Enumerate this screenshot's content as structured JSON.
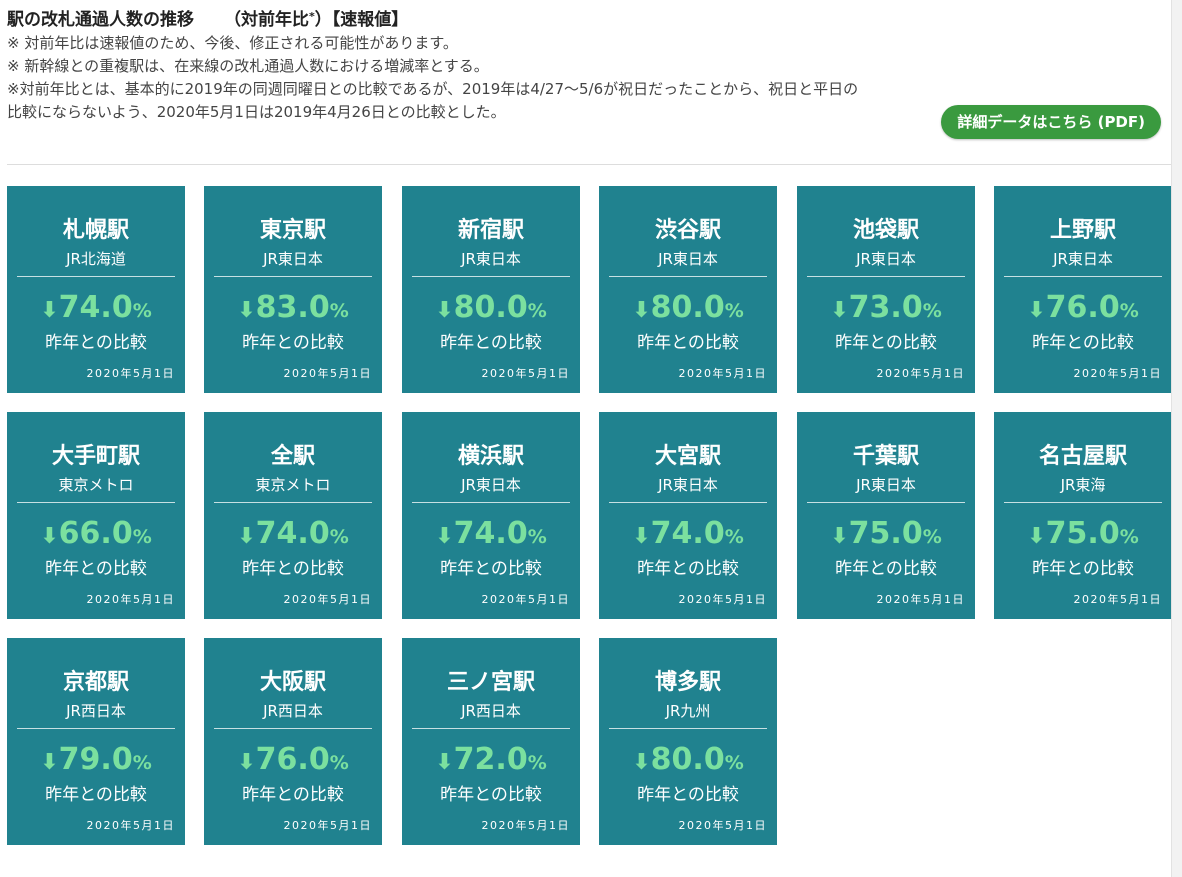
{
  "header": {
    "title_main": "駅の改札通過人数の推移",
    "title_yoy": "（対前年比",
    "title_mark": "*",
    "title_close": "）",
    "title_tag": "【速報値】",
    "notes": [
      "※ 対前年比は速報値のため、今後、修正される可能性があります。",
      "※ 新幹線との重複駅は、在来線の改札通過人数における増減率とする。",
      "※対前年比とは、基本的に2019年の同週同曜日との比較であるが、2019年は4/27～5/6が祝日だったことから、祝日と平日の比較にならないよう、2020年5月1日は2019年4月26日との比較とした。"
    ],
    "pdf_button": "詳細データはこちら (PDF)"
  },
  "colors": {
    "card_bg": "#20828f",
    "value_green": "#7be09f",
    "button_green": "#3a9a3f"
  },
  "stations": [
    {
      "name": "札幌駅",
      "operator": "JR北海道",
      "value": "74.0",
      "unit": "%",
      "arrow": "down-arrow-icon",
      "compare": "昨年との比較",
      "date": "2020年5月1日"
    },
    {
      "name": "東京駅",
      "operator": "JR東日本",
      "value": "83.0",
      "unit": "%",
      "arrow": "down-arrow-icon",
      "compare": "昨年との比較",
      "date": "2020年5月1日"
    },
    {
      "name": "新宿駅",
      "operator": "JR東日本",
      "value": "80.0",
      "unit": "%",
      "arrow": "down-arrow-icon",
      "compare": "昨年との比較",
      "date": "2020年5月1日"
    },
    {
      "name": "渋谷駅",
      "operator": "JR東日本",
      "value": "80.0",
      "unit": "%",
      "arrow": "down-arrow-icon",
      "compare": "昨年との比較",
      "date": "2020年5月1日"
    },
    {
      "name": "池袋駅",
      "operator": "JR東日本",
      "value": "73.0",
      "unit": "%",
      "arrow": "down-arrow-icon",
      "compare": "昨年との比較",
      "date": "2020年5月1日"
    },
    {
      "name": "上野駅",
      "operator": "JR東日本",
      "value": "76.0",
      "unit": "%",
      "arrow": "down-arrow-icon",
      "compare": "昨年との比較",
      "date": "2020年5月1日"
    },
    {
      "name": "大手町駅",
      "operator": "東京メトロ",
      "value": "66.0",
      "unit": "%",
      "arrow": "down-arrow-icon",
      "compare": "昨年との比較",
      "date": "2020年5月1日"
    },
    {
      "name": "全駅",
      "operator": "東京メトロ",
      "value": "74.0",
      "unit": "%",
      "arrow": "down-arrow-icon",
      "compare": "昨年との比較",
      "date": "2020年5月1日"
    },
    {
      "name": "横浜駅",
      "operator": "JR東日本",
      "value": "74.0",
      "unit": "%",
      "arrow": "down-arrow-icon",
      "compare": "昨年との比較",
      "date": "2020年5月1日"
    },
    {
      "name": "大宮駅",
      "operator": "JR東日本",
      "value": "74.0",
      "unit": "%",
      "arrow": "down-arrow-icon",
      "compare": "昨年との比較",
      "date": "2020年5月1日"
    },
    {
      "name": "千葉駅",
      "operator": "JR東日本",
      "value": "75.0",
      "unit": "%",
      "arrow": "down-arrow-icon",
      "compare": "昨年との比較",
      "date": "2020年5月1日"
    },
    {
      "name": "名古屋駅",
      "operator": "JR東海",
      "value": "75.0",
      "unit": "%",
      "arrow": "down-arrow-icon",
      "compare": "昨年との比較",
      "date": "2020年5月1日"
    },
    {
      "name": "京都駅",
      "operator": "JR西日本",
      "value": "79.0",
      "unit": "%",
      "arrow": "down-arrow-icon",
      "compare": "昨年との比較",
      "date": "2020年5月1日"
    },
    {
      "name": "大阪駅",
      "operator": "JR西日本",
      "value": "76.0",
      "unit": "%",
      "arrow": "down-arrow-icon",
      "compare": "昨年との比較",
      "date": "2020年5月1日"
    },
    {
      "name": "三ノ宮駅",
      "operator": "JR西日本",
      "value": "72.0",
      "unit": "%",
      "arrow": "down-arrow-icon",
      "compare": "昨年との比較",
      "date": "2020年5月1日"
    },
    {
      "name": "博多駅",
      "operator": "JR九州",
      "value": "80.0",
      "unit": "%",
      "arrow": "down-arrow-icon",
      "compare": "昨年との比較",
      "date": "2020年5月1日"
    }
  ]
}
